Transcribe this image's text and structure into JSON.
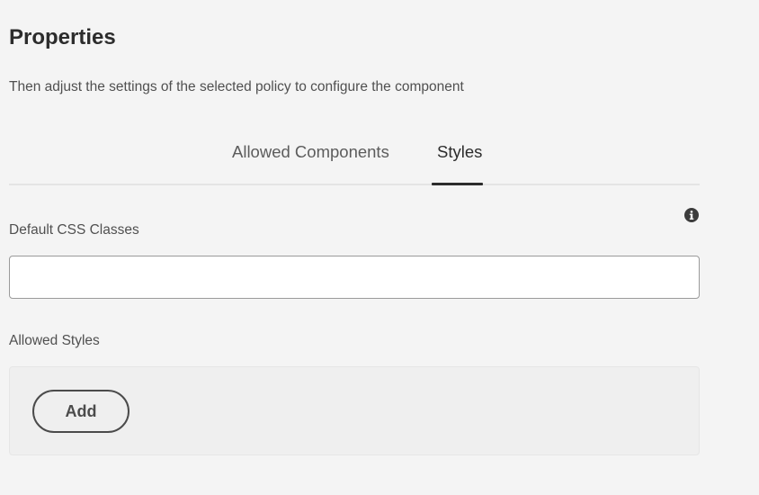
{
  "header": {
    "title": "Properties",
    "subtitle": "Then adjust the settings of the selected policy to configure the component"
  },
  "tabs": [
    {
      "label": "Allowed Components",
      "selected": false
    },
    {
      "label": "Styles",
      "selected": true
    }
  ],
  "default_css": {
    "label": "Default CSS Classes",
    "value": "",
    "placeholder": "",
    "info_icon": "info-icon"
  },
  "allowed_styles": {
    "label": "Allowed Styles",
    "add_label": "Add"
  },
  "colors": {
    "background": "#f4f4f4",
    "text": "#2c2c2c",
    "tab_indicator": "#2c2c2c",
    "button_border": "#4b4b4b"
  }
}
